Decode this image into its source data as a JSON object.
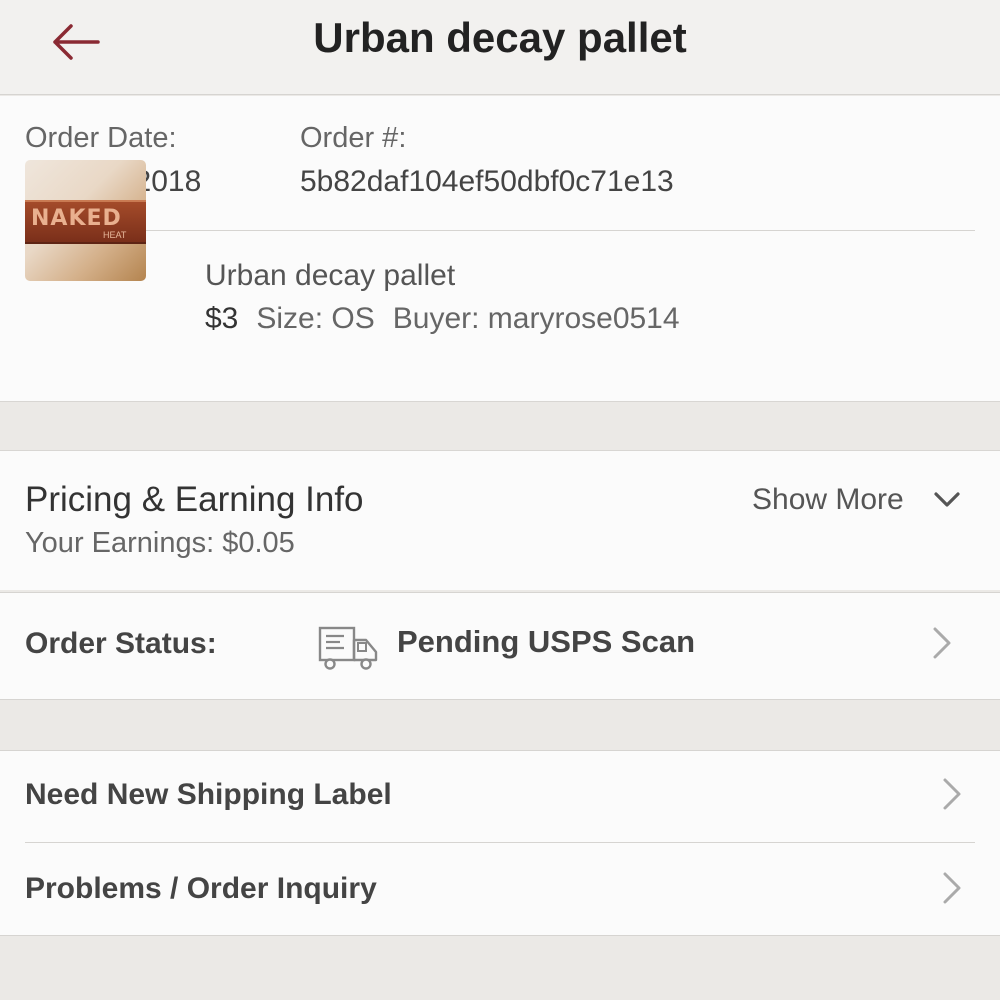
{
  "header": {
    "title": "Urban decay pallet",
    "back_icon": "arrow-left-icon",
    "accent_color": "#8a2a33"
  },
  "order": {
    "date_label": "Order Date:",
    "date_value": "Sep 11, 2018",
    "number_label": "Order #:",
    "number_value": "5b82daf104ef50dbf0c71e13"
  },
  "item": {
    "name": "Urban decay pallet",
    "price": "$3",
    "size": "Size: OS",
    "buyer": "Buyer: maryrose0514",
    "thumbnail_text": "NAKED",
    "thumbnail_subtext": "HEAT"
  },
  "pricing": {
    "title": "Pricing & Earning Info",
    "earnings": "Your Earnings: $0.05",
    "show_more": "Show More"
  },
  "status": {
    "label": "Order Status:",
    "value": "Pending USPS Scan",
    "icon": "truck-icon"
  },
  "actions": [
    {
      "label": "Need New Shipping Label"
    },
    {
      "label": "Problems / Order Inquiry"
    }
  ]
}
